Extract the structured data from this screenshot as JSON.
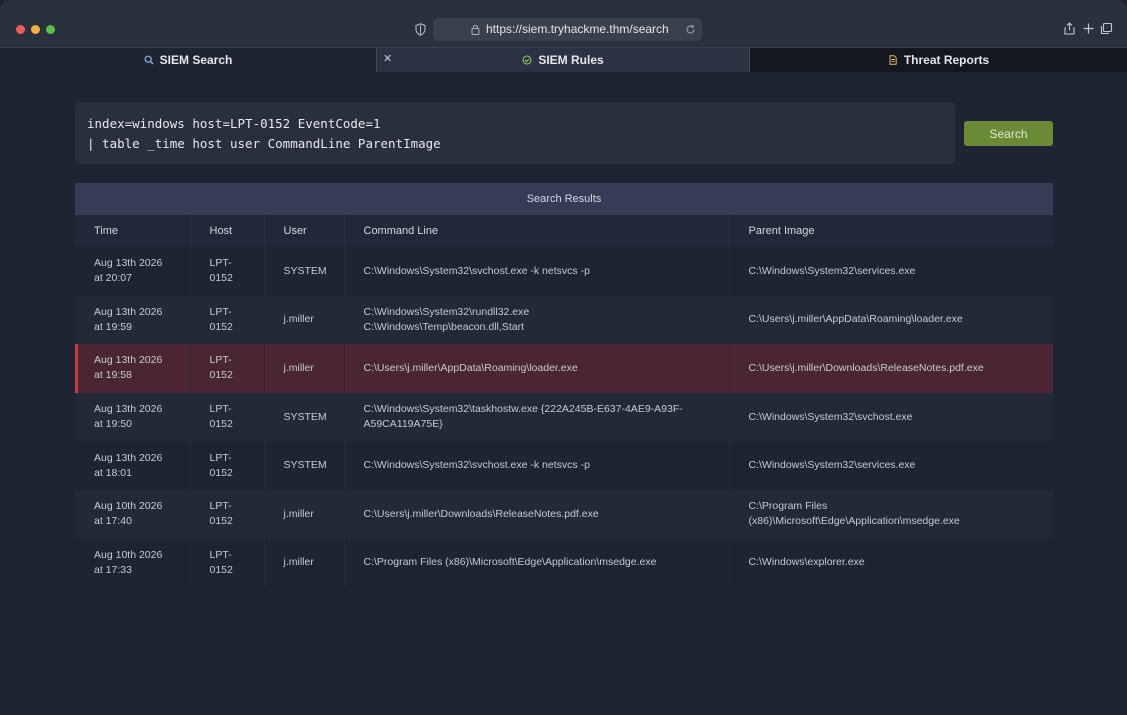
{
  "browser": {
    "url": "https://siem.tryhackme.thm/search"
  },
  "tabs": [
    {
      "label": "SIEM Search",
      "icon": "search-icon"
    },
    {
      "label": "SIEM Rules",
      "icon": "check-circle-icon"
    },
    {
      "label": "Threat Reports",
      "icon": "document-icon"
    }
  ],
  "query": {
    "line1": "index=windows host=LPT-0152 EventCode=1",
    "line2": "| table _time host user CommandLine ParentImage"
  },
  "search_button": "Search",
  "results": {
    "title": "Search Results",
    "columns": [
      "Time",
      "Host",
      "User",
      "Command Line",
      "Parent Image"
    ],
    "rows": [
      {
        "time1": "Aug 13th 2026",
        "time2": "at 20:07",
        "host1": "LPT-",
        "host2": "0152",
        "user": "SYSTEM",
        "cmd1": "C:\\Windows\\System32\\svchost.exe -k netsvcs -p",
        "cmd2": "",
        "parent1": "C:\\Windows\\System32\\services.exe",
        "parent2": ""
      },
      {
        "time1": "Aug 13th 2026",
        "time2": "at 19:59",
        "host1": "LPT-",
        "host2": "0152",
        "user": "j.miller",
        "cmd1": "C:\\Windows\\System32\\rundll32.exe",
        "cmd2": "C:\\Windows\\Temp\\beacon.dll,Start",
        "parent1": "C:\\Users\\j.miller\\AppData\\Roaming\\loader.exe",
        "parent2": ""
      },
      {
        "time1": "Aug 13th 2026",
        "time2": "at 19:58",
        "host1": "LPT-",
        "host2": "0152",
        "user": "j.miller",
        "cmd1": "C:\\Users\\j.miller\\AppData\\Roaming\\loader.exe",
        "cmd2": "",
        "parent1": "C:\\Users\\j.miller\\Downloads\\ReleaseNotes.pdf.exe",
        "parent2": "",
        "flagged": true
      },
      {
        "time1": "Aug 13th 2026",
        "time2": "at 19:50",
        "host1": "LPT-",
        "host2": "0152",
        "user": "SYSTEM",
        "cmd1": "C:\\Windows\\System32\\taskhostw.exe {222A245B-E637-4AE9-A93F-",
        "cmd2": "A59CA119A75E}",
        "parent1": "C:\\Windows\\System32\\svchost.exe",
        "parent2": ""
      },
      {
        "time1": "Aug 13th 2026",
        "time2": "at 18:01",
        "host1": "LPT-",
        "host2": "0152",
        "user": "SYSTEM",
        "cmd1": "C:\\Windows\\System32\\svchost.exe -k netsvcs -p",
        "cmd2": "",
        "parent1": "C:\\Windows\\System32\\services.exe",
        "parent2": ""
      },
      {
        "time1": "Aug 10th 2026",
        "time2": "at 17:40",
        "host1": "LPT-",
        "host2": "0152",
        "user": "j.miller",
        "cmd1": "C:\\Users\\j.miller\\Downloads\\ReleaseNotes.pdf.exe",
        "cmd2": "",
        "parent1": "C:\\Program Files",
        "parent2": "(x86)\\Microsoft\\Edge\\Application\\msedge.exe"
      },
      {
        "time1": "Aug 10th 2026",
        "time2": "at 17:33",
        "host1": "LPT-",
        "host2": "0152",
        "user": "j.miller",
        "cmd1": "C:\\Program Files (x86)\\Microsoft\\Edge\\Application\\msedge.exe",
        "cmd2": "",
        "parent1": "C:\\Windows\\explorer.exe",
        "parent2": ""
      }
    ]
  },
  "colors": {
    "accent_green": "#6a8a35",
    "flag_red": "#d03a3c",
    "flag_row_bg": "#4a2632",
    "header_bg": "#353d56"
  }
}
